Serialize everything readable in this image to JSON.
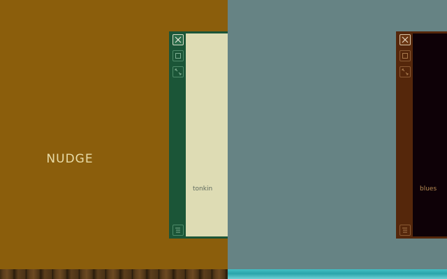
{
  "panes": {
    "left": {
      "label": "NUDGE",
      "background": "#8b5e0c",
      "window": {
        "title": "tonkin",
        "buttons": [
          "close-icon",
          "maximize-icon",
          "fullscreen-icon",
          "menu-icon"
        ],
        "frame_color": "#1b5537",
        "content_color": "#dedcb4"
      }
    },
    "right": {
      "label": "",
      "background": "#668384",
      "window": {
        "title": "blues",
        "buttons": [
          "close-icon",
          "maximize-icon",
          "fullscreen-icon",
          "menu-icon"
        ],
        "frame_color": "#55270b",
        "content_color": "#0e0107"
      }
    }
  }
}
